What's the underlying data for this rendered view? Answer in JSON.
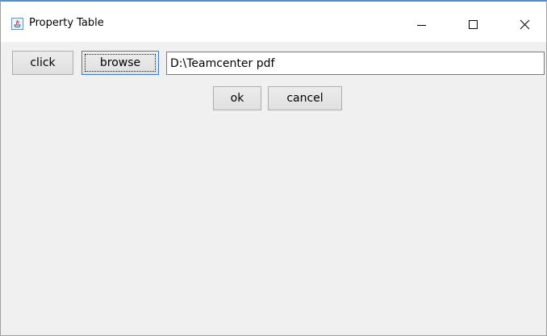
{
  "window": {
    "title": "Property Table"
  },
  "toolbar": {
    "click_label": "click",
    "browse_label": "browse",
    "path_value": "D:\\Teamcenter pdf"
  },
  "dialog": {
    "ok_label": "ok",
    "cancel_label": "cancel"
  },
  "icons": {
    "app": "java-icon",
    "minimize": "minimize-icon",
    "maximize": "maximize-icon",
    "close": "close-icon"
  },
  "colors": {
    "focus_border": "#3a7bd5",
    "window_background": "#f0f0f0",
    "titlebar_background": "#ffffff"
  }
}
